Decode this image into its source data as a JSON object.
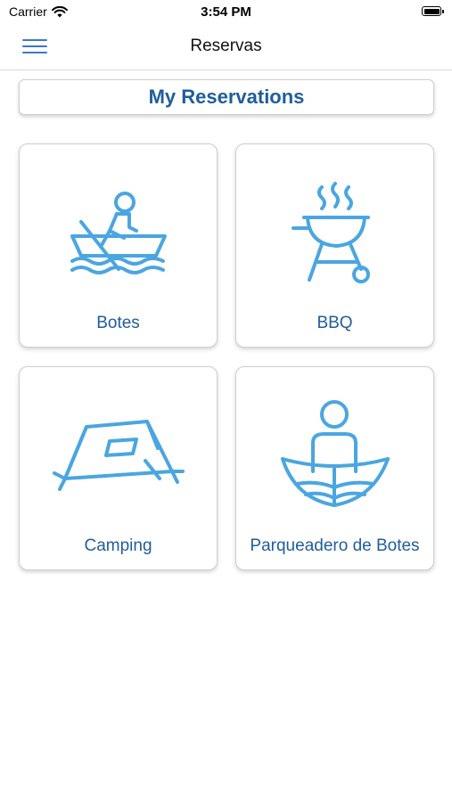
{
  "status_bar": {
    "carrier": "Carrier",
    "time": "3:54 PM"
  },
  "nav": {
    "title": "Reservas"
  },
  "reservations_button": {
    "label": "My Reservations"
  },
  "tiles": [
    {
      "label": "Botes",
      "icon": "rowboat-icon"
    },
    {
      "label": "BBQ",
      "icon": "grill-icon"
    },
    {
      "label": "Camping",
      "icon": "tent-icon"
    },
    {
      "label": "Parqueadero de Botes",
      "icon": "boat-parking-icon"
    }
  ],
  "colors": {
    "accent": "#1f5d9c",
    "icon": "#4aa6e0",
    "menu": "#3a78c4"
  }
}
